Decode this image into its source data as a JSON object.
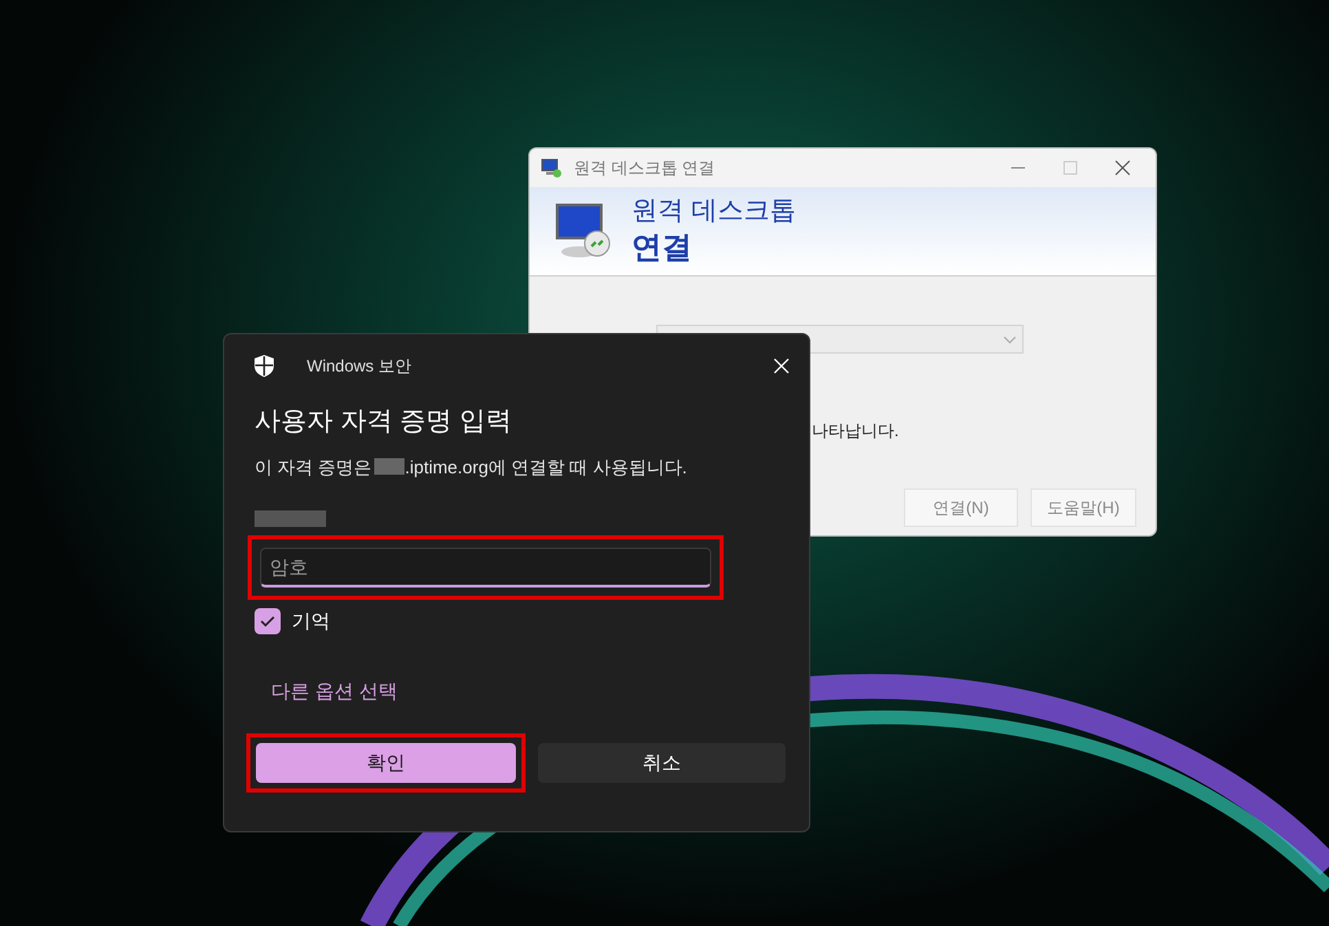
{
  "background_window": {
    "title": "원격 데스크톱 연결",
    "header_line_1": "원격 데스크톱",
    "header_line_2": "연결",
    "computer_dropdown": {
      "disabled": true
    },
    "partial_text": "나타납니다.",
    "buttons": [
      {
        "label": "연결(N)",
        "disabled": true
      },
      {
        "label": "도움말(H)",
        "disabled": true
      }
    ]
  },
  "security_dialog": {
    "app_name": "Windows 보안",
    "heading": "사용자 자격 증명 입력",
    "message_before": "이 자격 증명은",
    "message_after": ".iptime.org에 연결할 때 사용됩니다.",
    "password_field": {
      "placeholder": "암호",
      "highlighted": true
    },
    "remember": {
      "label": "기억",
      "checked": true
    },
    "more_options_link": "다른 옵션 선택",
    "buttons": [
      {
        "label": "확인",
        "primary": true,
        "highlighted": true
      },
      {
        "label": "취소",
        "primary": false,
        "highlighted": false
      }
    ]
  }
}
